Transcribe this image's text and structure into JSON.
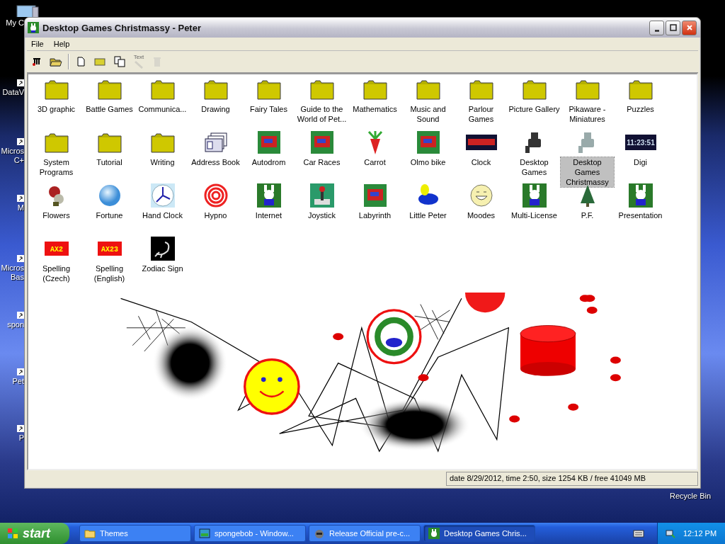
{
  "desktop": {
    "icons": [
      {
        "label": "My C",
        "kind": "computer"
      },
      {
        "label": "DataV",
        "kind": "shortcut"
      },
      {
        "label": "Micros C+",
        "kind": "shortcut"
      },
      {
        "label": "M",
        "kind": "shortcut"
      },
      {
        "label": "Micros Bas",
        "kind": "shortcut"
      },
      {
        "label": "spon",
        "kind": "shortcut"
      },
      {
        "label": "Pet",
        "kind": "shortcut"
      },
      {
        "label": "P",
        "kind": "shortcut"
      }
    ],
    "recycle_bin": "Recycle Bin"
  },
  "window": {
    "title": "Desktop Games Christmassy - Peter",
    "menu": [
      "File",
      "Help"
    ],
    "toolbar": [
      {
        "kind": "tree",
        "disabled": false
      },
      {
        "kind": "open",
        "disabled": false
      },
      {
        "kind": "new",
        "disabled": false
      },
      {
        "kind": "folder",
        "disabled": false
      },
      {
        "kind": "copy",
        "disabled": false
      },
      {
        "kind": "text",
        "label": "Text",
        "disabled": true
      },
      {
        "kind": "delete",
        "disabled": true
      }
    ],
    "items": [
      {
        "label": "3D graphic",
        "kind": "folder",
        "selected": false
      },
      {
        "label": "Battle Games",
        "kind": "folder",
        "selected": false
      },
      {
        "label": "Communica...",
        "kind": "folder",
        "selected": false
      },
      {
        "label": "Drawing",
        "kind": "folder",
        "selected": false
      },
      {
        "label": "Fairy Tales",
        "kind": "folder",
        "selected": false
      },
      {
        "label": "Guide to the World of Pet...",
        "kind": "folder",
        "selected": false
      },
      {
        "label": "Mathematics",
        "kind": "folder",
        "selected": false
      },
      {
        "label": "Music and Sound",
        "kind": "folder",
        "selected": false
      },
      {
        "label": "Parlour Games",
        "kind": "folder",
        "selected": false
      },
      {
        "label": "Picture Gallery",
        "kind": "folder",
        "selected": false
      },
      {
        "label": "Pikaware - Miniatures",
        "kind": "folder",
        "selected": false
      },
      {
        "label": "Puzzles",
        "kind": "folder",
        "selected": false
      },
      {
        "label": "System Programs",
        "kind": "folder",
        "selected": false
      },
      {
        "label": "Tutorial",
        "kind": "folder",
        "selected": false
      },
      {
        "label": "Writing",
        "kind": "folder",
        "selected": false
      },
      {
        "label": "Address Book",
        "kind": "documents",
        "selected": false
      },
      {
        "label": "Autodrom",
        "kind": "picture",
        "selected": false
      },
      {
        "label": "Car Races",
        "kind": "picture",
        "selected": false
      },
      {
        "label": "Carrot",
        "kind": "carrot",
        "selected": false
      },
      {
        "label": "Olmo bike",
        "kind": "picture",
        "selected": false
      },
      {
        "label": "Clock",
        "kind": "display",
        "selected": false
      },
      {
        "label": "Desktop Games",
        "kind": "camera",
        "selected": false
      },
      {
        "label": "Desktop Games Christmassy",
        "kind": "camera",
        "selected": true
      },
      {
        "label": "Digi",
        "kind": "display",
        "icon_text": "11:23:51",
        "selected": false
      },
      {
        "label": "Flowers",
        "kind": "flower",
        "selected": false
      },
      {
        "label": "Fortune",
        "kind": "sphere",
        "selected": false
      },
      {
        "label": "Hand Clock",
        "kind": "clock",
        "selected": false
      },
      {
        "label": "Hypno",
        "kind": "spiral",
        "selected": false
      },
      {
        "label": "Internet",
        "kind": "bunny",
        "selected": false
      },
      {
        "label": "Joystick",
        "kind": "joystick",
        "selected": false
      },
      {
        "label": "Labyrinth",
        "kind": "picture",
        "selected": false
      },
      {
        "label": "Little Peter",
        "kind": "pacifier",
        "selected": false
      },
      {
        "label": "Moodes",
        "kind": "smiley",
        "selected": false
      },
      {
        "label": "Multi-License",
        "kind": "bunny",
        "selected": false
      },
      {
        "label": "P.F.",
        "kind": "tree",
        "selected": false
      },
      {
        "label": "Presentation",
        "kind": "bunny",
        "selected": false
      },
      {
        "label": "Spelling (Czech)",
        "kind": "tile",
        "icon_text": "AX2",
        "selected": false
      },
      {
        "label": "Spelling (English)",
        "kind": "tile",
        "icon_text": "AX23",
        "selected": false
      },
      {
        "label": "Zodiac Sign",
        "kind": "scorpion",
        "selected": false
      }
    ],
    "status_bar": "date 8/29/2012, time 2:50, size 1254 KB / free 41049 MB"
  },
  "taskbar": {
    "start": "start",
    "tasks": [
      {
        "label": "Themes",
        "kind": "folder",
        "selected": false
      },
      {
        "label": "spongebob - Window...",
        "kind": "picture",
        "selected": false
      },
      {
        "label": "Release Official pre-c...",
        "kind": "animal",
        "selected": false
      },
      {
        "label": "Desktop Games Chris...",
        "kind": "bunny",
        "selected": true
      }
    ],
    "clock": "12:12 PM"
  }
}
